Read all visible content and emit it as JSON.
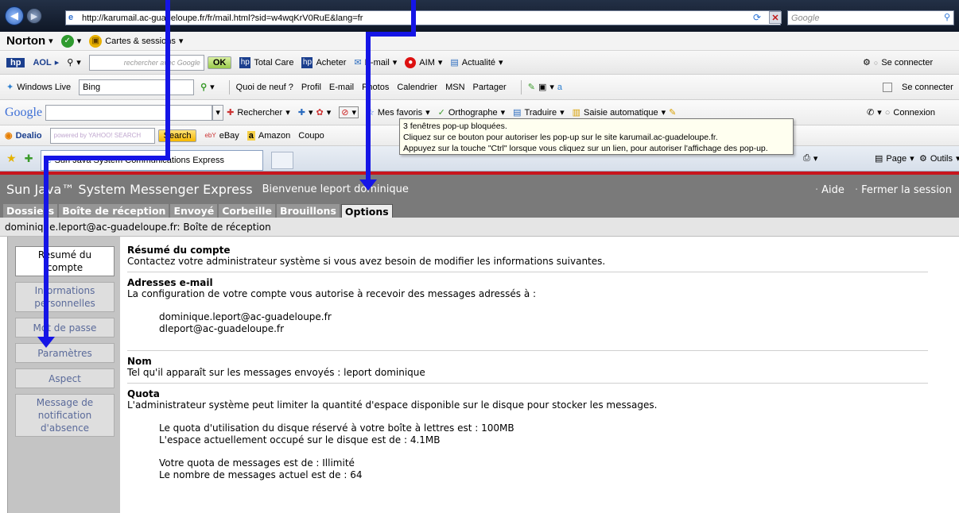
{
  "browser": {
    "url": "http://karumail.ac-guadeloupe.fr/fr/mail.html?sid=w4wqKrV0RuE&lang=fr",
    "search_placeholder": "Google",
    "norton": {
      "logo": "Norton",
      "cards_label": "Cartes & sessions"
    },
    "aol_toolbar": {
      "aol_label": "AOL",
      "search_hint": "rechercher avec Google",
      "ok_label": "OK",
      "total_care": "Total Care",
      "acheter": "Acheter",
      "email": "E-mail",
      "aim": "AIM",
      "actualite": "Actualité",
      "connect": "Se connecter"
    },
    "windows_live": {
      "brand": "Windows Live",
      "search_value": "Bing",
      "links": [
        "Quoi de neuf ?",
        "Profil",
        "E-mail",
        "Photos",
        "Calendrier",
        "MSN",
        "Partager"
      ],
      "connect": "Se connecter"
    },
    "google_toolbar": {
      "logo": "Google",
      "rechercher": "Rechercher",
      "mes_favoris": "Mes favoris",
      "orthographe": "Orthographe",
      "traduire": "Traduire",
      "saisie": "Saisie automatique",
      "connexion": "Connexion"
    },
    "dealio": {
      "brand": "Dealio",
      "search_placeholder": "powered by YAHOO! SEARCH",
      "search_btn": "Search",
      "ebay": "eBay",
      "amazon": "Amazon",
      "coupons": "Coupo"
    },
    "tab_title": "Sun Java System Communications Express",
    "page_menu": "Page",
    "tools_menu": "Outils",
    "popup_tooltip": [
      "3 fenêtres pop-up bloquées.",
      "Cliquez sur ce bouton pour autoriser les pop-up sur le site karumail.ac-guadeloupe.fr.",
      "Appuyez sur la touche \"Ctrl\" lorsque vous cliquez sur un lien, pour autoriser l'affichage des pop-up."
    ]
  },
  "app": {
    "title": "Sun Java™ System Messenger Express",
    "welcome": "Bienvenue leport dominique",
    "help": "Aide",
    "logout": "Fermer la session",
    "tabs": [
      "Dossiers",
      "Boîte de réception",
      "Envoyé",
      "Corbeille",
      "Brouillons",
      "Options"
    ],
    "active_tab": "Options",
    "folder_line": "dominique.leport@ac-guadeloupe.fr: Boîte de réception",
    "nav": [
      "Résumé du compte",
      "Informations personnelles",
      "Mot de passe",
      "Paramètres",
      "Aspect",
      "Message de notification d'absence"
    ],
    "content": {
      "summary_title": "Résumé du compte",
      "summary_text": "Contactez votre administrateur système si vous avez besoin de modifier les informations suivantes.",
      "email_title": "Adresses e-mail",
      "email_text": "La configuration de votre compte vous autorise à recevoir des messages adressés à :",
      "email_addresses": [
        "dominique.leport@ac-guadeloupe.fr",
        "dleport@ac-guadeloupe.fr"
      ],
      "name_title": "Nom",
      "name_text": "Tel qu'il apparaît sur les messages envoyés : leport dominique",
      "quota_title": "Quota",
      "quota_text": "L'administrateur système peut limiter la quantité d'espace disponible sur le disque pour stocker les messages.",
      "quota_disk_reserved": "Le quota d'utilisation du disque réservé à votre boîte à lettres est : 100MB",
      "quota_disk_used": "L'espace actuellement occupé sur le disque est de : 4.1MB",
      "quota_messages": "Votre quota de messages est de : Illimité",
      "quota_message_count": "Le nombre de messages actuel est de : 64"
    }
  },
  "colors": {
    "annotation_arrow": "#1515e6",
    "header_red": "#c8151d",
    "header_gray": "#7a7a7a"
  }
}
